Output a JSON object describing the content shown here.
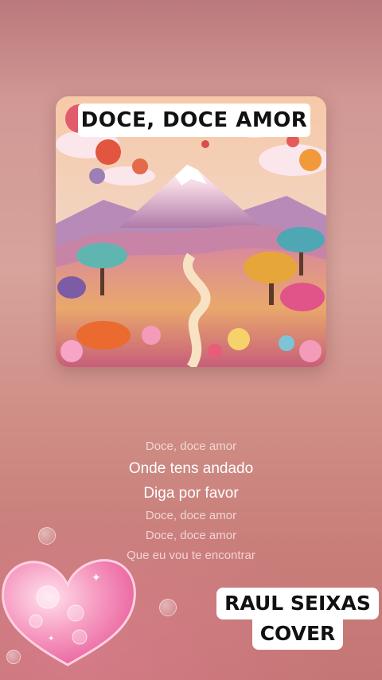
{
  "song": {
    "cover_title": "DOCE, DOCE AMOR"
  },
  "lyrics": [
    {
      "text": "Doce, doce amor",
      "state": "past"
    },
    {
      "text": "Onde tens andado",
      "state": "active"
    },
    {
      "text": "Diga por favor",
      "state": "active"
    },
    {
      "text": "Doce, doce amor",
      "state": "upcoming"
    },
    {
      "text": "Doce, doce amor",
      "state": "upcoming"
    },
    {
      "text": "Que eu vou te encontrar",
      "state": "upcoming"
    }
  ],
  "artist_badge": {
    "line1": "RAUL SEIXAS",
    "line2": "COVER"
  },
  "colors": {
    "background": "#d29a96",
    "lyric_active": "#ffffff",
    "heart": "#f48bb7"
  },
  "icons": [
    "heart-icon"
  ]
}
